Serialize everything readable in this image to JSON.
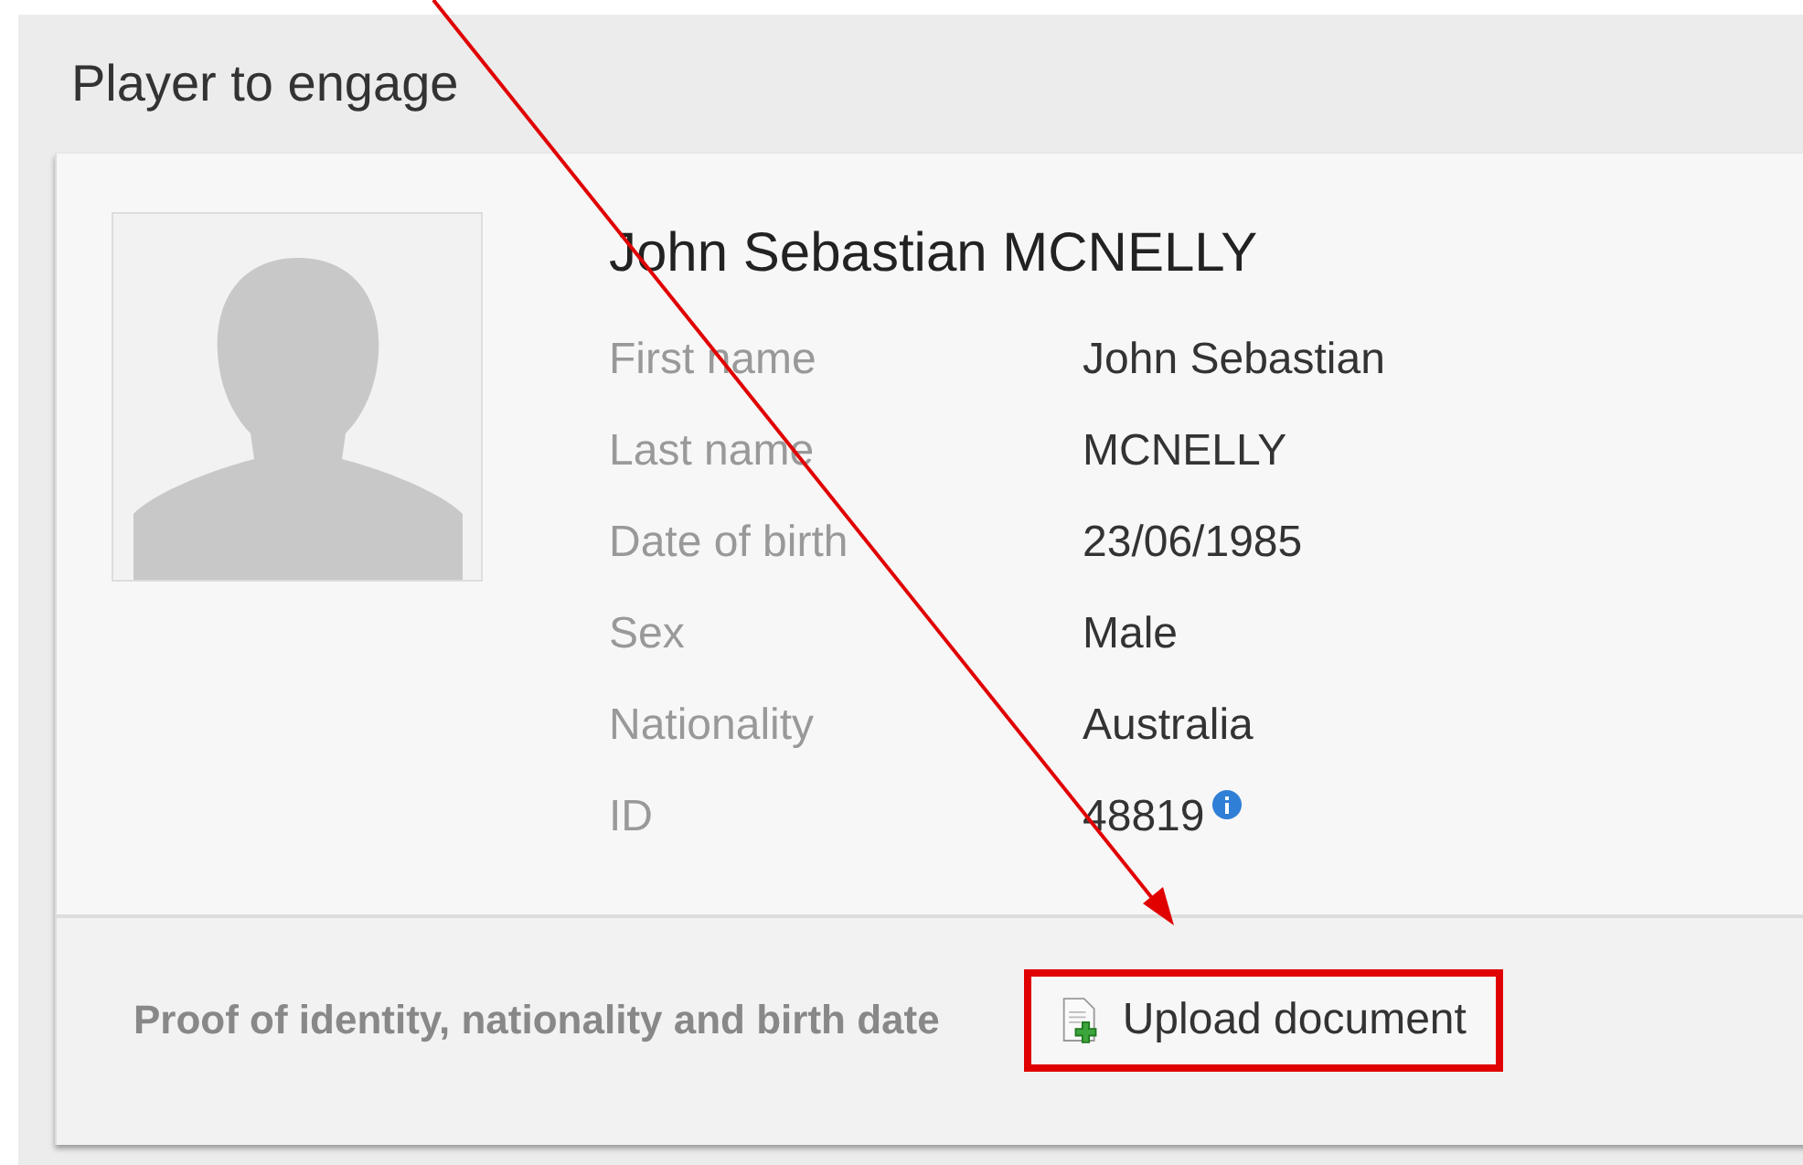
{
  "panel": {
    "title": "Player to engage"
  },
  "player": {
    "full_name": "John Sebastian MCNELLY",
    "fields": [
      {
        "label": "First name",
        "value": "John Sebastian"
      },
      {
        "label": "Last name",
        "value": "MCNELLY"
      },
      {
        "label": "Date of birth",
        "value": "23/06/1985"
      },
      {
        "label": "Sex",
        "value": "Male"
      },
      {
        "label": "Nationality",
        "value": "Australia"
      },
      {
        "label": "ID",
        "value": "48819",
        "info": true
      }
    ]
  },
  "footer": {
    "text": "Proof of identity, nationality and birth date",
    "button": "Upload document",
    "highlighted": true
  }
}
